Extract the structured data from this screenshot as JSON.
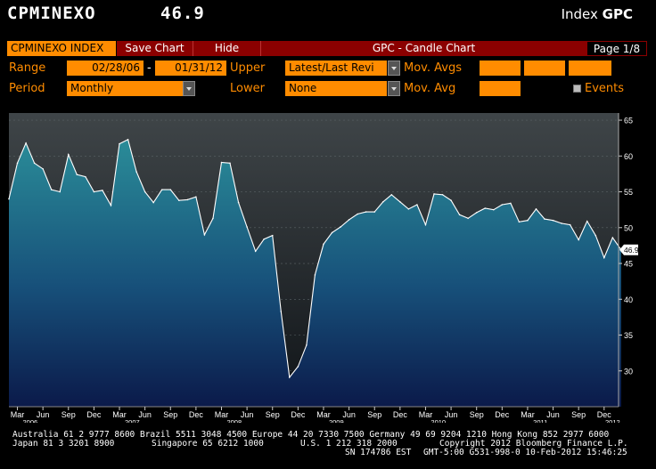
{
  "header": {
    "ticker": "CPMINEXO",
    "value": "46.9",
    "index_label": "Index",
    "index_code": "GPC"
  },
  "toolbar": {
    "security_tab": "CPMINEXO INDEX",
    "save_label": "Save Chart",
    "hide_label": "Hide",
    "title": "GPC - Candle Chart",
    "page": "Page 1/8"
  },
  "controls": {
    "range_label": "Range",
    "range_start": "02/28/06",
    "range_sep": "-",
    "range_end": "01/31/12",
    "upper_label": "Upper",
    "upper_value": "Latest/Last Revi",
    "mov_avgs_label": "Mov. Avgs",
    "period_label": "Period",
    "period_value": "Monthly",
    "lower_label": "Lower",
    "lower_value": "None",
    "mov_avg_label": "Mov. Avg",
    "events_label": "Events"
  },
  "colors": {
    "orange": "#ff8c00",
    "redbar": "#8b0000",
    "area_top": "#2a8c98",
    "area_bottom": "#0b1a4a",
    "plot_bg_top": "#3f4548",
    "plot_bg_bottom": "#101418",
    "line": "#ffffff"
  },
  "chart_data": {
    "type": "area",
    "y_ticks": [
      30,
      35,
      40,
      45,
      50,
      55,
      60,
      65
    ],
    "ylim": [
      25,
      66
    ],
    "last_value_label": "46.9",
    "x_month_ticks": [
      "Mar",
      "Jun",
      "Sep",
      "Dec",
      "Mar",
      "Jun",
      "Sep",
      "Dec",
      "Mar",
      "Jun",
      "Sep",
      "Dec",
      "Mar",
      "Jun",
      "Sep",
      "Dec",
      "Mar",
      "Jun",
      "Sep",
      "Dec",
      "Mar",
      "Jun",
      "Sep",
      "Dec"
    ],
    "x_year_labels": [
      "2006",
      "2007",
      "2008",
      "2009",
      "2010",
      "2011",
      "2012"
    ],
    "x": [
      "2006-02",
      "2006-03",
      "2006-04",
      "2006-05",
      "2006-06",
      "2006-07",
      "2006-08",
      "2006-09",
      "2006-10",
      "2006-11",
      "2006-12",
      "2007-01",
      "2007-02",
      "2007-03",
      "2007-04",
      "2007-05",
      "2007-06",
      "2007-07",
      "2007-08",
      "2007-09",
      "2007-10",
      "2007-11",
      "2007-12",
      "2008-01",
      "2008-02",
      "2008-03",
      "2008-04",
      "2008-05",
      "2008-06",
      "2008-07",
      "2008-08",
      "2008-09",
      "2008-10",
      "2008-11",
      "2008-12",
      "2009-01",
      "2009-02",
      "2009-03",
      "2009-04",
      "2009-05",
      "2009-06",
      "2009-07",
      "2009-08",
      "2009-09",
      "2009-10",
      "2009-11",
      "2009-12",
      "2010-01",
      "2010-02",
      "2010-03",
      "2010-04",
      "2010-05",
      "2010-06",
      "2010-07",
      "2010-08",
      "2010-09",
      "2010-10",
      "2010-11",
      "2010-12",
      "2011-01",
      "2011-02",
      "2011-03",
      "2011-04",
      "2011-05",
      "2011-06",
      "2011-07",
      "2011-08",
      "2011-09",
      "2011-10",
      "2011-11",
      "2011-12",
      "2012-01"
    ],
    "values": [
      54,
      59,
      61.8,
      59,
      58.2,
      55.3,
      55,
      60.2,
      57.4,
      57.1,
      55,
      55.2,
      53.1,
      61.7,
      62.3,
      57.8,
      55,
      53.5,
      55.3,
      55.3,
      53.8,
      53.9,
      54.3,
      49,
      51.3,
      59.1,
      59,
      53.5,
      50.1,
      46.7,
      48.4,
      48.9,
      38.3,
      29.1,
      30.6,
      33.6,
      43.4,
      47.7,
      49.3,
      50.1,
      51.1,
      51.9,
      52.2,
      52.2,
      53.6,
      54.6,
      53.6,
      52.6,
      53.2,
      50.4,
      54.7,
      54.6,
      53.8,
      51.8,
      51.3,
      52.1,
      52.7,
      52.5,
      53.2,
      53.4,
      50.8,
      51,
      52.6,
      51.2,
      51,
      50.6,
      50.4,
      48.3,
      50.9,
      48.9,
      45.8,
      48.6,
      46.9
    ]
  },
  "footer": {
    "line1": "Australia 61 2 9777 8600 Brazil 5511 3048 4500 Europe 44 20 7330 7500 Germany 49 69 9204 1210 Hong Kong 852 2977 6000",
    "line2a": "Japan 81 3 3201 8900",
    "line2b": "Singapore 65 6212 1000",
    "line2c": "U.S. 1 212 318 2000",
    "line2d": "Copyright 2012 Bloomberg Finance L.P.",
    "line3a": "SN 174786 EST",
    "line3b": "GMT-5:00 G531-998-0 10-Feb-2012 15:46:25"
  }
}
